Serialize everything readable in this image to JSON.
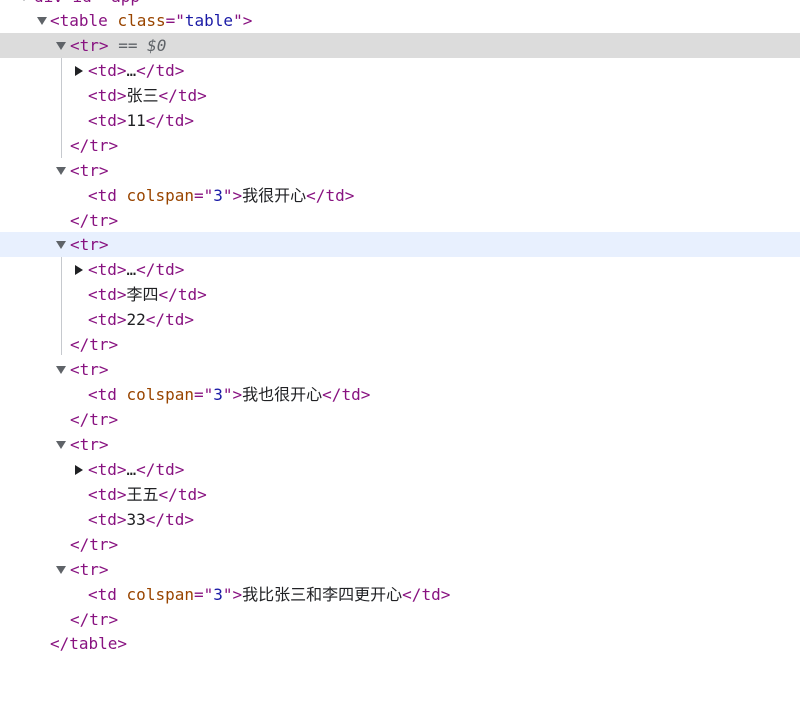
{
  "top_partial": {
    "text": "div id=\"app\""
  },
  "table_tag": {
    "open_lt": "<",
    "name": "table",
    "attr": "class",
    "eq_q": "=\"",
    "val": "table",
    "q_gt": "\">",
    "close": "</table>"
  },
  "selected_marker": "== $0",
  "strings": {
    "lt": "<",
    "gt": ">",
    "tr": "tr",
    "tr_close": "</tr>",
    "td_open": "<td>",
    "td_close": "</td>",
    "ellipsis": "…",
    "td_sp": "td",
    "colspan": "colspan",
    "eq_q": "=\"",
    "q_gt": "\">"
  },
  "rows": [
    {
      "cells": [
        "张三",
        "11"
      ],
      "message": "我很开心",
      "colspan": "3"
    },
    {
      "cells": [
        "李四",
        "22"
      ],
      "message": "我也很开心",
      "colspan": "3"
    },
    {
      "cells": [
        "王五",
        "33"
      ],
      "message": "我比张三和李四更开心",
      "colspan": "3"
    }
  ]
}
